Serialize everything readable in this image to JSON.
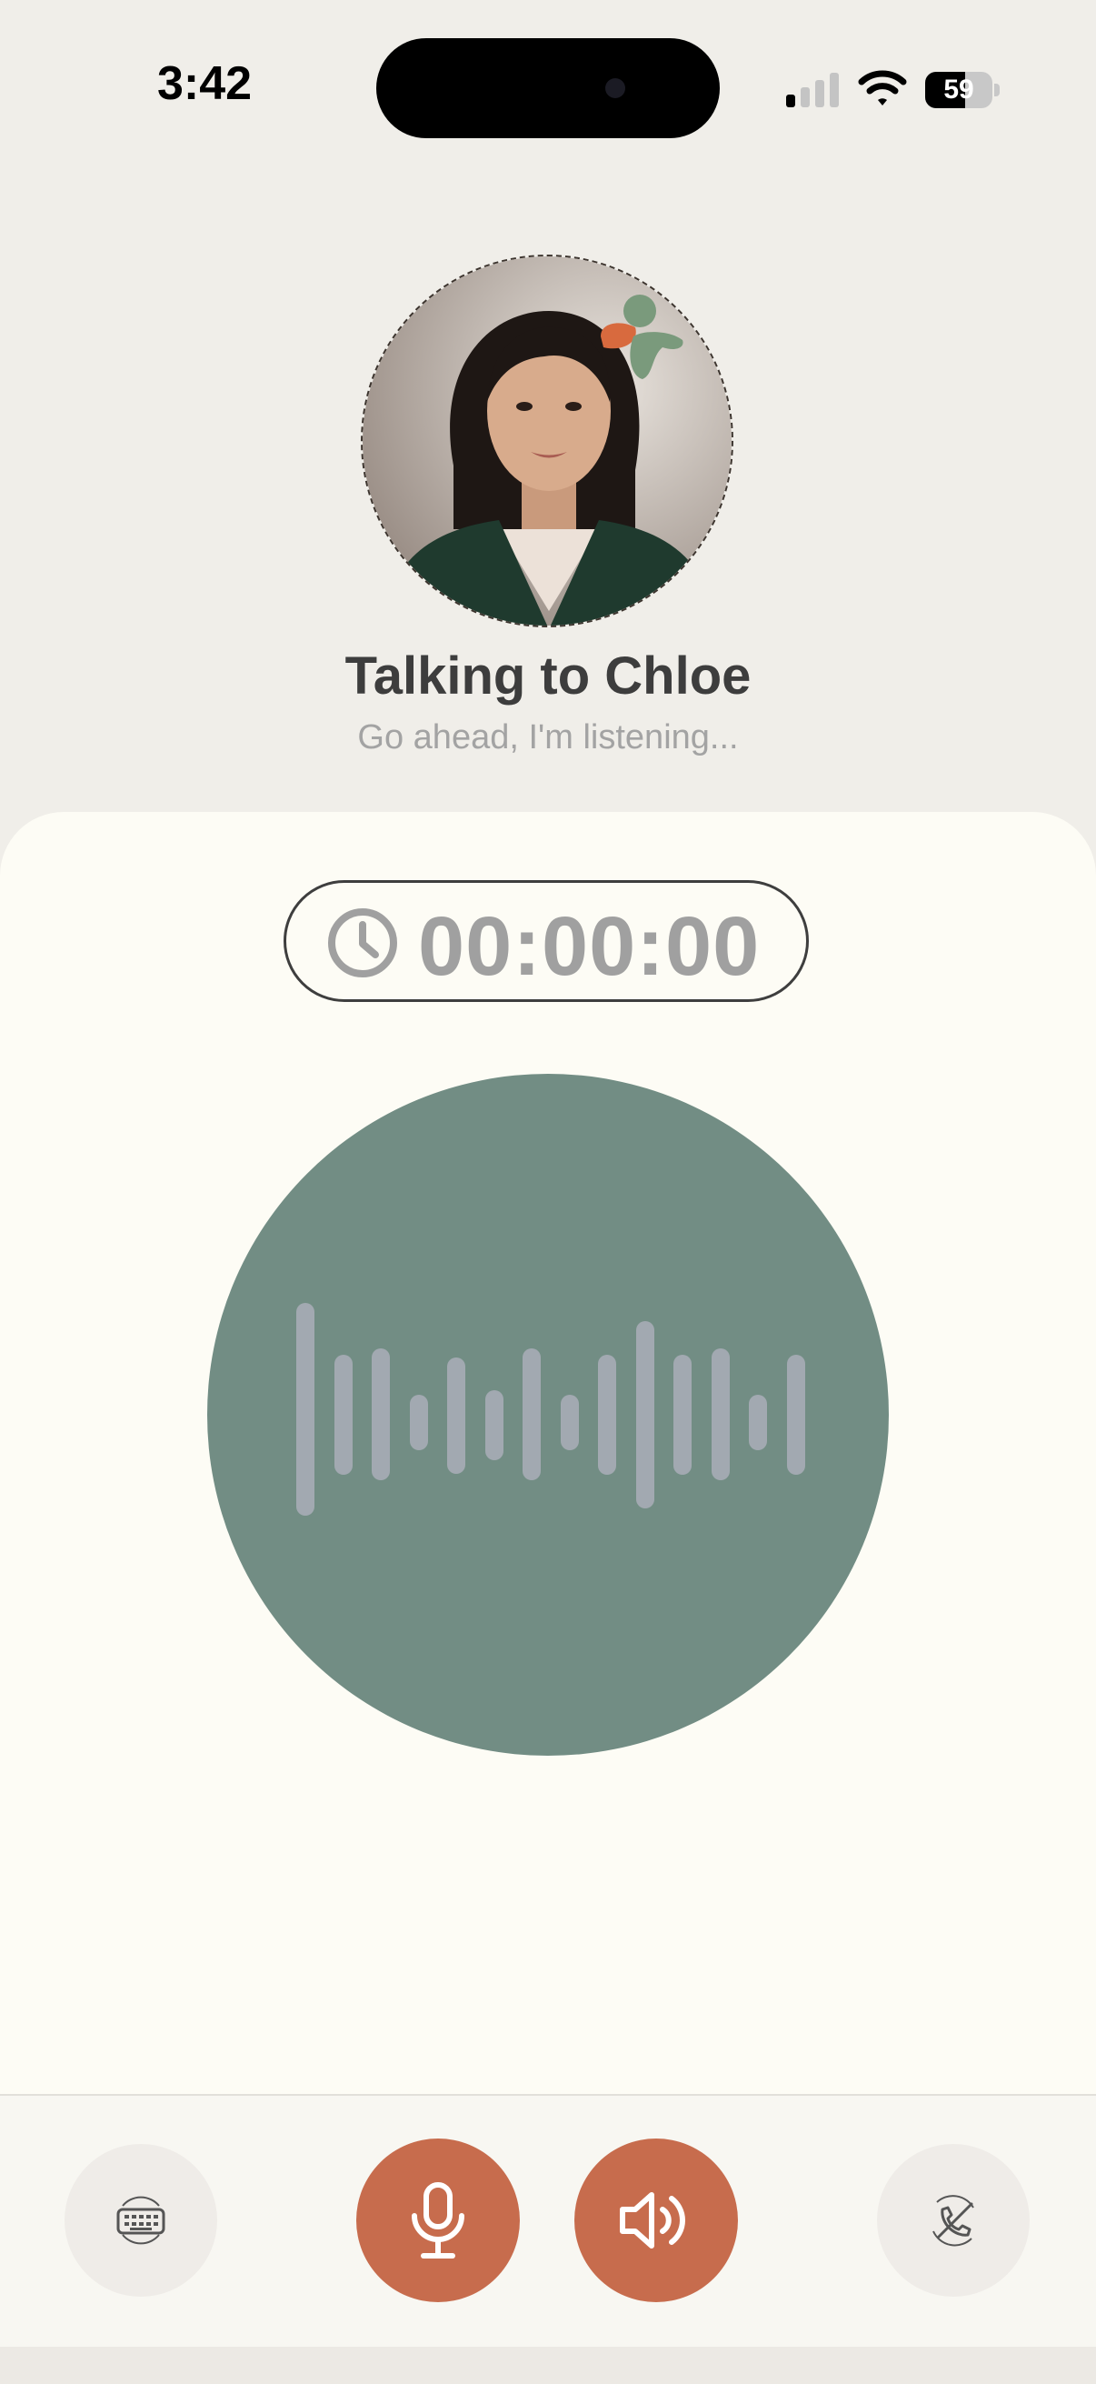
{
  "status_bar": {
    "time": "3:42",
    "battery": "59",
    "battery_level": 0.59
  },
  "header": {
    "title": "Talking to Chloe",
    "subtitle": "Go ahead, I'm listening..."
  },
  "timer": {
    "value": "00:00:00",
    "icon": "clock-icon"
  },
  "controls": {
    "keyboard_icon": "keyboard-icon",
    "mic_icon": "microphone-icon",
    "speaker_icon": "speaker-icon",
    "end_call_icon": "phone-hangup-icon"
  },
  "colors": {
    "accent": "#c76c4d",
    "orb": "#728d84",
    "card_bg": "#fdfcf5",
    "page_bg": "#f0eee9",
    "wave": "#a2a9b1"
  }
}
